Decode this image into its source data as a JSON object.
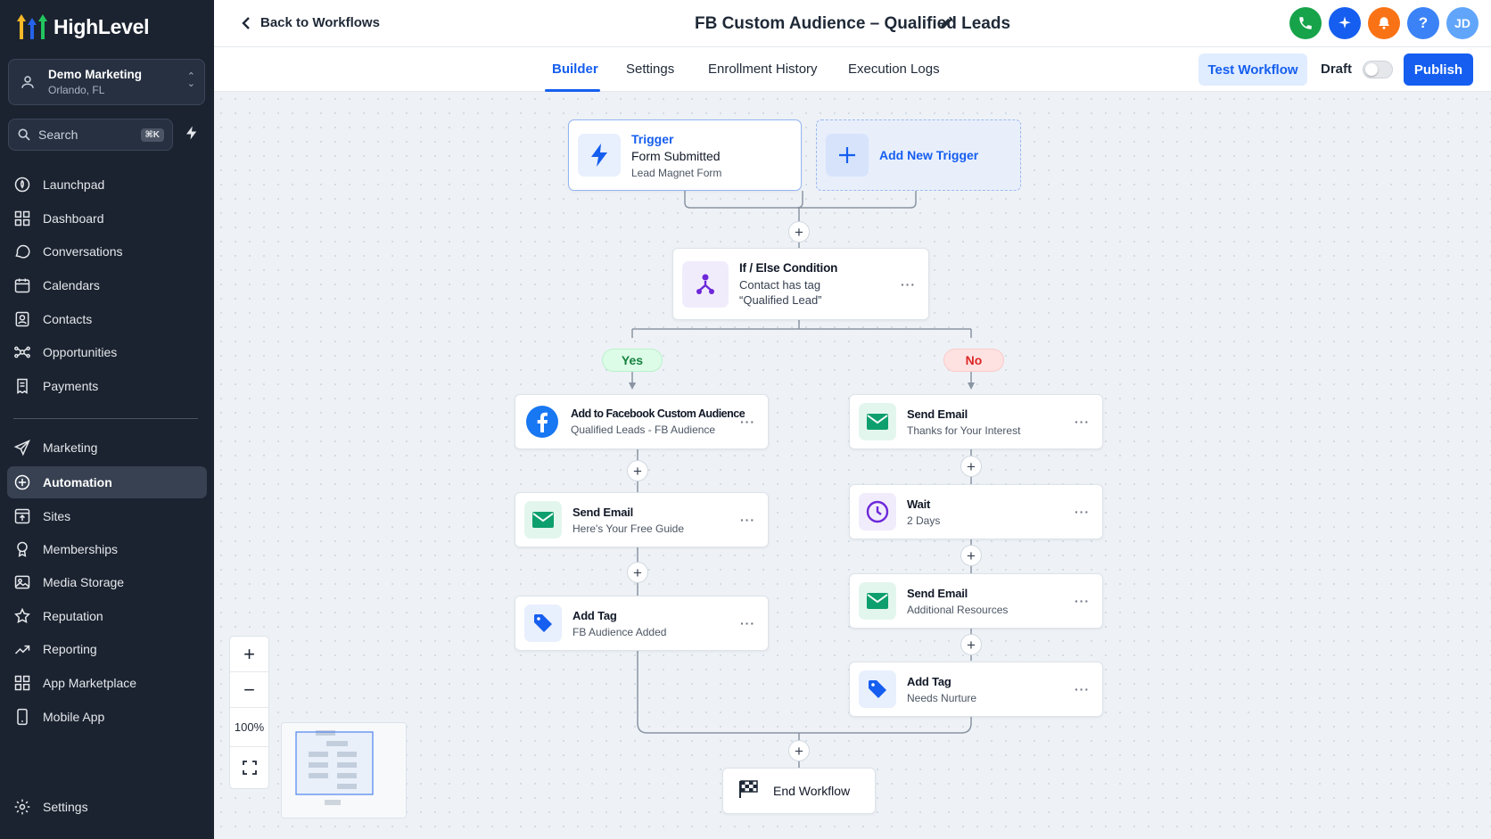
{
  "brand": {
    "name": "HighLevel"
  },
  "account": {
    "name": "Demo Marketing",
    "location": "Orlando, FL"
  },
  "search": {
    "placeholder": "Search",
    "shortcut": "⌘K"
  },
  "sidebar": {
    "items": [
      {
        "label": "Launchpad",
        "icon": "rocket-icon"
      },
      {
        "label": "Dashboard",
        "icon": "grid-icon"
      },
      {
        "label": "Conversations",
        "icon": "chat-icon"
      },
      {
        "label": "Calendars",
        "icon": "calendar-icon"
      },
      {
        "label": "Contacts",
        "icon": "contacts-icon"
      },
      {
        "label": "Opportunities",
        "icon": "opportunities-icon"
      },
      {
        "label": "Payments",
        "icon": "receipt-icon"
      },
      {
        "label": "Marketing",
        "icon": "send-icon"
      },
      {
        "label": "Automation",
        "icon": "automation-icon",
        "active": true
      },
      {
        "label": "Sites",
        "icon": "sites-icon"
      },
      {
        "label": "Memberships",
        "icon": "memberships-icon"
      },
      {
        "label": "Media Storage",
        "icon": "image-icon"
      },
      {
        "label": "Reputation",
        "icon": "star-icon"
      },
      {
        "label": "Reporting",
        "icon": "trend-icon"
      },
      {
        "label": "App Marketplace",
        "icon": "apps-icon"
      },
      {
        "label": "Mobile App",
        "icon": "phone-icon"
      }
    ],
    "settings_label": "Settings"
  },
  "header": {
    "back_label": "Back to Workflows",
    "title": "FB Custom Audience – Qualified Leads",
    "user_initials": "JD"
  },
  "tabs": [
    {
      "label": "Builder",
      "active": true
    },
    {
      "label": "Settings"
    },
    {
      "label": "Enrollment History"
    },
    {
      "label": "Execution Logs"
    }
  ],
  "actions": {
    "test_label": "Test Workflow",
    "draft_label": "Draft",
    "draft_enabled": false,
    "publish_label": "Publish"
  },
  "workflow": {
    "trigger": {
      "kind": "Trigger",
      "title": "Form Submitted",
      "subtitle": "Lead Magnet Form"
    },
    "add_trigger_label": "Add New Trigger",
    "condition": {
      "title": "If / Else Condition",
      "line1": "Contact has tag",
      "line2": "“Qualified Lead”"
    },
    "yes_label": "Yes",
    "no_label": "No",
    "yes_branch": [
      {
        "title": "Add to Facebook Custom Audience",
        "subtitle": "Qualified Leads - FB Audience",
        "icon": "facebook-icon"
      },
      {
        "title": "Send Email",
        "subtitle": "Here's Your Free Guide",
        "icon": "email-icon"
      },
      {
        "title": "Add Tag",
        "subtitle": "FB Audience Added",
        "icon": "tag-icon"
      }
    ],
    "no_branch": [
      {
        "title": "Send Email",
        "subtitle": "Thanks for Your Interest",
        "icon": "email-icon"
      },
      {
        "title": "Wait",
        "subtitle": "2 Days",
        "icon": "clock-icon"
      },
      {
        "title": "Send Email",
        "subtitle": "Additional Resources",
        "icon": "email-icon"
      },
      {
        "title": "Add Tag",
        "subtitle": "Needs Nurture",
        "icon": "tag-icon"
      }
    ],
    "end_label": "End Workflow"
  },
  "zoom": {
    "level": "100%"
  },
  "colors": {
    "accent": "#155eef",
    "sidebar_bg": "#1b2330",
    "email_green": "#0e9f6e",
    "condition_purple": "#6d28d9",
    "yes_bg": "#dcfce7",
    "no_bg": "#fee2e2"
  }
}
